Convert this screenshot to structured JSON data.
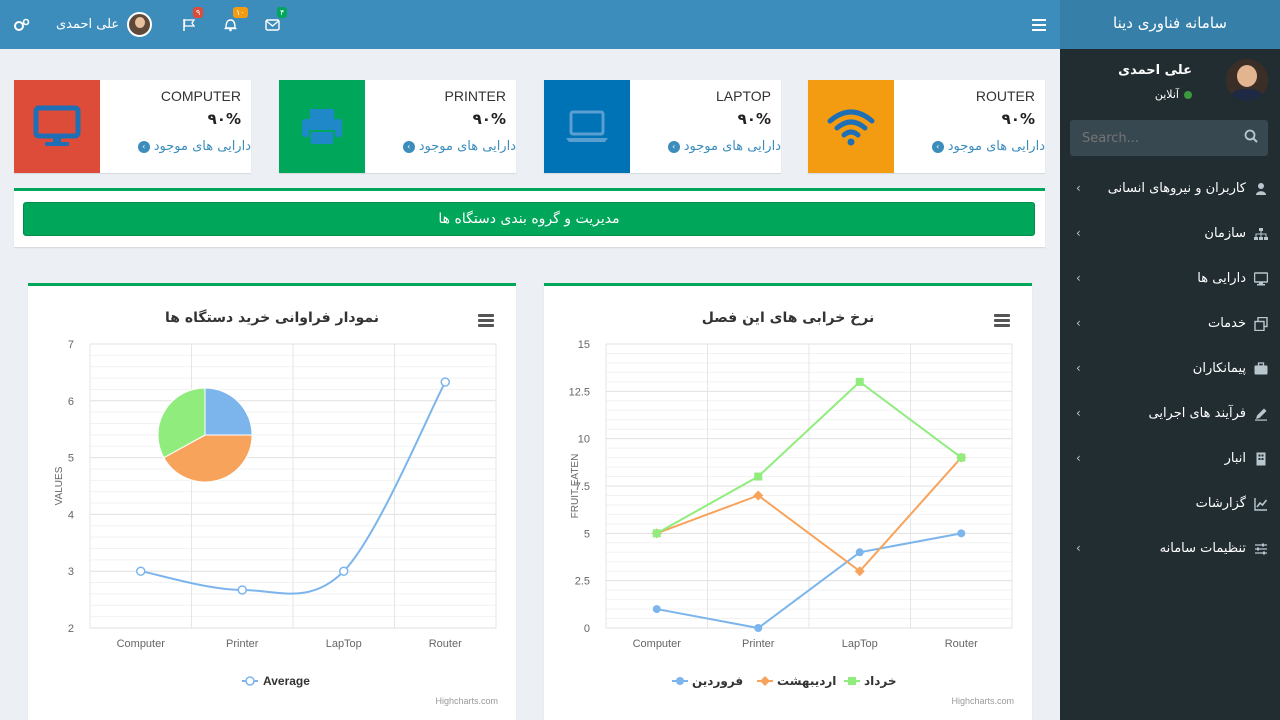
{
  "header": {
    "brand": "سامانه فناوری دینا",
    "user_name": "علی احمدی",
    "badges": {
      "flags": "۹",
      "bell": "۱۰",
      "mail": "۴"
    },
    "colors": {
      "flags": "#dd4b39",
      "bell": "#f39c12",
      "mail": "#00a65a"
    }
  },
  "sidebar": {
    "user_name": "علی احمدی",
    "status": "آنلاین",
    "search_placeholder": "Search...",
    "items": [
      {
        "label": "کاربران و نیروهای انسانی",
        "icon": "user-icon",
        "chevron": true
      },
      {
        "label": "سازمان",
        "icon": "sitemap-icon",
        "chevron": true
      },
      {
        "label": "دارایی ها",
        "icon": "desktop-icon",
        "chevron": true
      },
      {
        "label": "خدمات",
        "icon": "clone-icon",
        "chevron": true
      },
      {
        "label": "پیمانکاران",
        "icon": "briefcase-icon",
        "chevron": true
      },
      {
        "label": "فرآیند های اجرایی",
        "icon": "edit-icon",
        "chevron": true
      },
      {
        "label": "انبار",
        "icon": "building-icon",
        "chevron": true
      },
      {
        "label": "گزارشات",
        "icon": "line-chart-icon",
        "chevron": false
      },
      {
        "label": "تنظیمات سامانه",
        "icon": "sliders-icon",
        "chevron": true
      }
    ]
  },
  "info_boxes": [
    {
      "title": "COMPUTER",
      "value": "۹۰%",
      "link": "دارایی های موجود",
      "color": "#dd4b39",
      "icon": "desktop-icon"
    },
    {
      "title": "PRINTER",
      "value": "۹۰%",
      "link": "دارایی های موجود",
      "color": "#00a65a",
      "icon": "print-icon"
    },
    {
      "title": "LAPTOP",
      "value": "۹۰%",
      "link": "دارایی های موجود",
      "color": "#0073b7",
      "icon": "laptop-icon"
    },
    {
      "title": "ROUTER",
      "value": "۹۰%",
      "link": "دارایی های موجود",
      "color": "#f39c12",
      "icon": "wifi-icon"
    }
  ],
  "manage_button": "مدیریت و گروه بندی دستگاه ها",
  "chart_data": [
    {
      "type": "line",
      "title": "نمودار فراوانی خرید دستگاه ها",
      "ylabel": "VALUES",
      "xlabel": "",
      "categories": [
        "Computer",
        "Printer",
        "LapTop",
        "Router"
      ],
      "ylim": [
        2,
        7
      ],
      "yticks": [
        2,
        3,
        4,
        5,
        6,
        7
      ],
      "series": [
        {
          "name": "Average",
          "values": [
            3,
            2.67,
            3,
            6.33
          ],
          "color": "#7cb5ec"
        }
      ],
      "pie": {
        "slices": [
          {
            "value": 25,
            "color": "#7cb5ec"
          },
          {
            "value": 42,
            "color": "#f7a35c"
          },
          {
            "value": 33,
            "color": "#90ed7d"
          }
        ]
      },
      "credit": "Highcharts.com",
      "legend": "bottom-center",
      "grid": true
    },
    {
      "type": "line",
      "title": "نرخ خرابی های این فصل",
      "ylabel": "FRUIT EATEN",
      "xlabel": "",
      "categories": [
        "Computer",
        "Printer",
        "LapTop",
        "Router"
      ],
      "ylim": [
        0,
        15
      ],
      "yticks": [
        0,
        2.5,
        5,
        7.5,
        10,
        12.5,
        15
      ],
      "series": [
        {
          "name": "فروردین",
          "values": [
            1,
            0,
            4,
            5
          ],
          "color": "#7cb5ec",
          "marker": "circle"
        },
        {
          "name": "اردیبهشت",
          "values": [
            5,
            7,
            3,
            9
          ],
          "color": "#f7a35c",
          "marker": "diamond"
        },
        {
          "name": "خرداد",
          "values": [
            5,
            8,
            13,
            9
          ],
          "color": "#90ed7d",
          "marker": "square"
        }
      ],
      "credit": "Highcharts.com",
      "legend": "bottom-center",
      "grid": true
    }
  ]
}
